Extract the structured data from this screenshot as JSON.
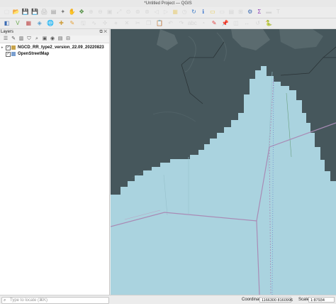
{
  "window": {
    "title": "*Untitled Project — QGIS"
  },
  "colors": {
    "sea": "#aad3df",
    "dark_overlay": "#3d4d52",
    "admin_boundary": "#a98bb5",
    "layer_group_icon": "#c7a34a",
    "osm_icon": "#7a9fd0"
  },
  "toolbar_row1": [
    {
      "name": "new-project-icon",
      "glyph": "▢",
      "color": "#dddddd"
    },
    {
      "name": "open-project-icon",
      "glyph": "📂",
      "color": "#e2b43a"
    },
    {
      "name": "save-project-icon",
      "glyph": "💾",
      "color": "#3b6bb3"
    },
    {
      "name": "save-as-icon",
      "glyph": "💾",
      "color": "#5f86c4"
    },
    {
      "name": "print-layout-icon",
      "glyph": "🖨",
      "color": "#bbbbbb"
    },
    {
      "name": "layout-manager-icon",
      "glyph": "▤",
      "color": "#999999"
    },
    {
      "name": "style-manager-icon",
      "glyph": "✦",
      "color": "#777777"
    },
    {
      "name": "pan-icon",
      "glyph": "✋",
      "color": "#cfcfcf"
    },
    {
      "name": "pan-to-selection-icon",
      "glyph": "✥",
      "color": "#4a8a3a"
    },
    {
      "name": "zoom-in-icon",
      "glyph": "⊕",
      "color": "#d8d8d8"
    },
    {
      "name": "zoom-out-icon",
      "glyph": "⊖",
      "color": "#d8d8d8"
    },
    {
      "name": "zoom-1to1-icon",
      "glyph": "▣",
      "color": "#d8d8d8"
    },
    {
      "name": "zoom-full-icon",
      "glyph": "⤢",
      "color": "#d8d8d8"
    },
    {
      "name": "zoom-selection-icon",
      "glyph": "⊙",
      "color": "#d8d8d8"
    },
    {
      "name": "zoom-layer-icon",
      "glyph": "⊚",
      "color": "#d8d8d8"
    },
    {
      "name": "zoom-native-icon",
      "glyph": "⊛",
      "color": "#d8d8d8"
    },
    {
      "name": "zoom-last-icon",
      "glyph": "◁",
      "color": "#d8d8d8"
    },
    {
      "name": "zoom-next-icon",
      "glyph": "▷",
      "color": "#d8d8d8"
    },
    {
      "name": "new-map-view-icon",
      "glyph": "▦",
      "color": "#e8d28a"
    },
    {
      "name": "temporal-icon",
      "glyph": "◷",
      "color": "#d8d8d8"
    },
    {
      "name": "refresh-icon",
      "glyph": "↻",
      "color": "#3b7bc8"
    },
    {
      "name": "identify-icon",
      "glyph": "ℹ",
      "color": "#4a7fd0"
    },
    {
      "name": "select-icon",
      "glyph": "▭",
      "color": "#e6c84a"
    },
    {
      "name": "deselect-icon",
      "glyph": "▭",
      "color": "#d6d6d6"
    },
    {
      "name": "open-table-icon",
      "glyph": "▤",
      "color": "#d6d6d6"
    },
    {
      "name": "field-calc-icon",
      "glyph": "⊞",
      "color": "#d6d6d6"
    },
    {
      "name": "processing-icon",
      "glyph": "⚙",
      "color": "#3b6bb3"
    },
    {
      "name": "statistics-icon",
      "glyph": "Σ",
      "color": "#8e3bb3"
    },
    {
      "name": "measure-icon",
      "glyph": "▬",
      "color": "#d6d6d6"
    },
    {
      "name": "annotation-icon",
      "glyph": "T",
      "color": "#d6d6d6"
    }
  ],
  "toolbar_row2": [
    {
      "name": "data-source-manager-icon",
      "glyph": "◧",
      "color": "#3b6bb3"
    },
    {
      "name": "add-vector-icon",
      "glyph": "V",
      "color": "#6aa84f"
    },
    {
      "name": "add-raster-icon",
      "glyph": "▦",
      "color": "#c05050"
    },
    {
      "name": "add-mesh-icon",
      "glyph": "◈",
      "color": "#5aa0d0"
    },
    {
      "name": "add-wms-icon",
      "glyph": "🌐",
      "color": "#4a90d0"
    },
    {
      "name": "new-layer-icon",
      "glyph": "✚",
      "color": "#d0a040"
    },
    {
      "name": "toggle-editing-icon",
      "glyph": "✎",
      "color": "#e6a23a"
    },
    {
      "name": "save-edits-icon",
      "glyph": "🖫",
      "color": "#d6d6d6"
    },
    {
      "name": "digitize-icon",
      "glyph": "∿",
      "color": "#d6d6d6"
    },
    {
      "name": "move-feature-icon",
      "glyph": "✢",
      "color": "#d6d6d6"
    },
    {
      "name": "node-tool-icon",
      "glyph": "⋄",
      "color": "#d6d6d6"
    },
    {
      "name": "delete-icon",
      "glyph": "✕",
      "color": "#d6d6d6"
    },
    {
      "name": "cut-icon",
      "glyph": "✂",
      "color": "#d6d6d6"
    },
    {
      "name": "copy-icon",
      "glyph": "❐",
      "color": "#d6d6d6"
    },
    {
      "name": "paste-icon",
      "glyph": "📋",
      "color": "#d6d6d6"
    },
    {
      "name": "undo-icon",
      "glyph": "↶",
      "color": "#d6d6d6"
    },
    {
      "name": "redo-icon",
      "glyph": "↷",
      "color": "#d6d6d6"
    },
    {
      "name": "label-icon",
      "glyph": "abc",
      "color": "#d6d6d6"
    },
    {
      "name": "diagram-icon",
      "glyph": "◔",
      "color": "#d6d6d6"
    },
    {
      "name": "highlight-icon",
      "glyph": "✎",
      "color": "#e04040"
    },
    {
      "name": "pin-label-icon",
      "glyph": "📌",
      "color": "#d6d6d6"
    },
    {
      "name": "show-label-icon",
      "glyph": "◫",
      "color": "#d6d6d6"
    },
    {
      "name": "move-label-icon",
      "glyph": "↔",
      "color": "#d6d6d6"
    },
    {
      "name": "rotate-label-icon",
      "glyph": "↺",
      "color": "#d6d6d6"
    },
    {
      "name": "python-console-icon",
      "glyph": "🐍",
      "color": "#3b6bb3"
    }
  ],
  "layers_panel": {
    "title": "Layers",
    "float_button": "⧉",
    "close_button": "✕",
    "tools": [
      "☰",
      "✎",
      "▥",
      "⛉",
      "⌕",
      "▣",
      "◉",
      "▤",
      "⊟"
    ],
    "items": [
      {
        "name": "NGCD_RR_type2_version_22.09_20220823",
        "checked": "✓",
        "expander": "▸"
      },
      {
        "name": "OpenStreetMap",
        "checked": "✓",
        "expander": ""
      }
    ]
  },
  "statusbar": {
    "locator_placeholder": "Type to locate (⌘K)",
    "search_icon": "⌕",
    "coordinate_label": "Coordinate",
    "coordinate_value": "1166300 8160996",
    "scale_label": "Scale",
    "scale_value": "1:87934"
  }
}
